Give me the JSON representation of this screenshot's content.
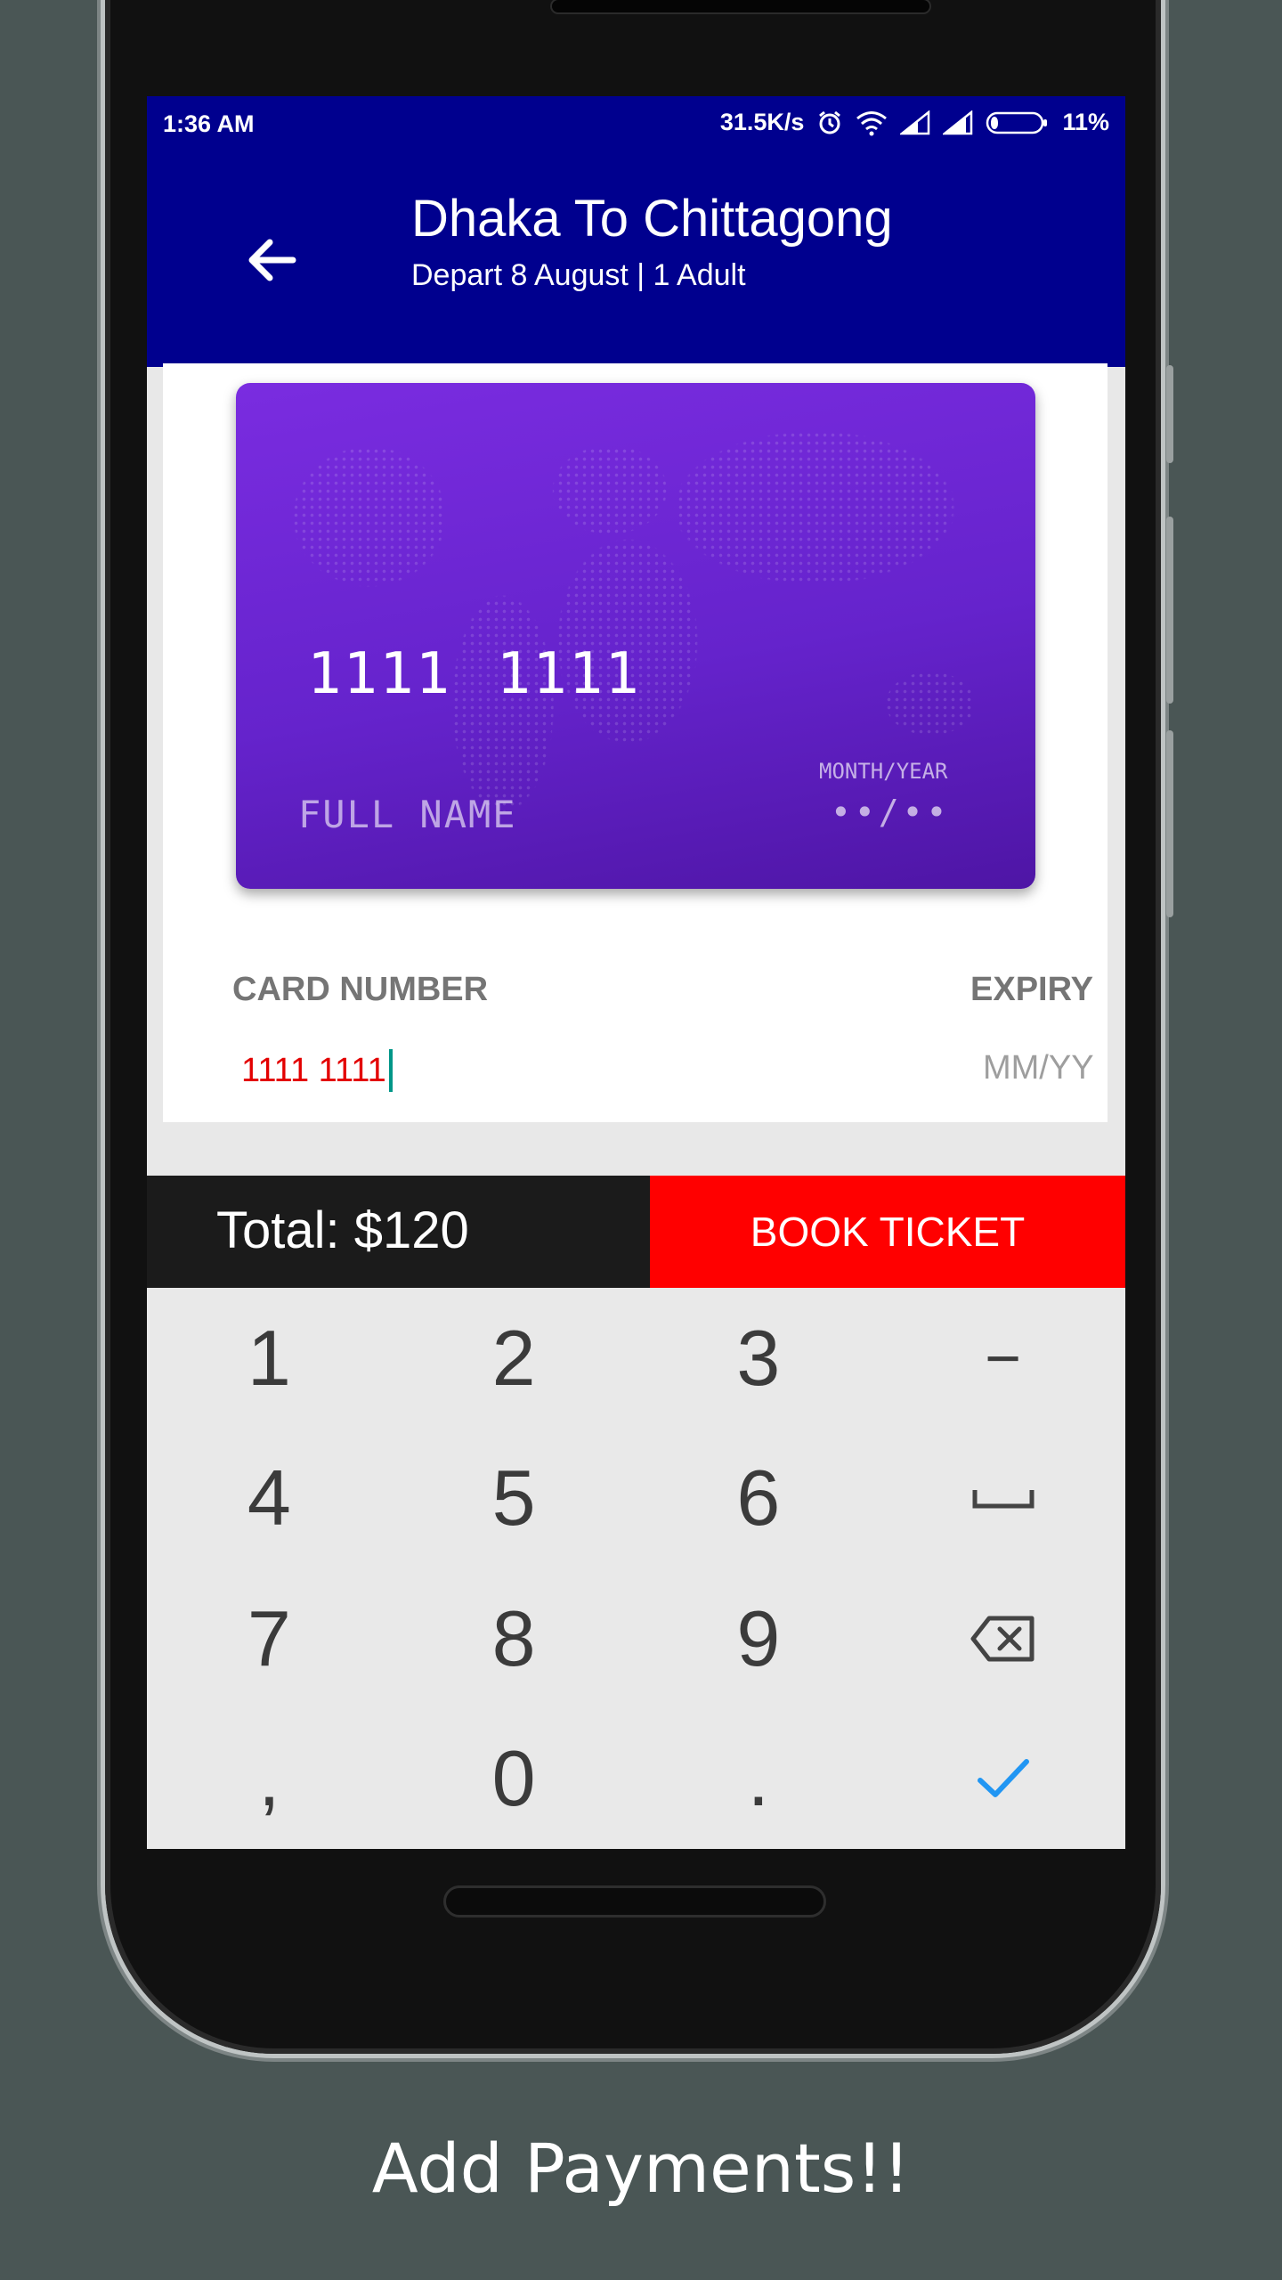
{
  "status_bar": {
    "time": "1:36 AM",
    "network_speed": "31.5K/s",
    "battery": "11%",
    "icons": [
      "alarm-icon",
      "wifi-icon",
      "signal-icon",
      "signal-icon",
      "battery-icon"
    ]
  },
  "header": {
    "title": "Dhaka To Chittagong",
    "subtitle": "Depart 8 August | 1 Adult",
    "back_icon": "arrow-left-icon"
  },
  "card_preview": {
    "number": "1111  1111",
    "name": "FULL NAME",
    "expiry_label": "MONTH/YEAR",
    "expiry_value": "••/••"
  },
  "form": {
    "card_number_label": "CARD NUMBER",
    "card_number_value": "1111 1111",
    "expiry_label": "EXPIRY",
    "expiry_placeholder": "MM/YY"
  },
  "footer": {
    "total": "Total: $120",
    "book_label": "BOOK TICKET"
  },
  "keypad": {
    "keys": [
      "1",
      "2",
      "3",
      "−",
      "4",
      "5",
      "6",
      "space-icon",
      "7",
      "8",
      "9",
      "backspace-icon",
      ",",
      "0",
      ".",
      "check-icon"
    ]
  },
  "caption": "Add Payments!!",
  "colors": {
    "appbar": "#00008e",
    "card": "#6a26d4",
    "book_button": "#ff0000",
    "input_text": "#e30000",
    "accent": "#2196f3"
  }
}
